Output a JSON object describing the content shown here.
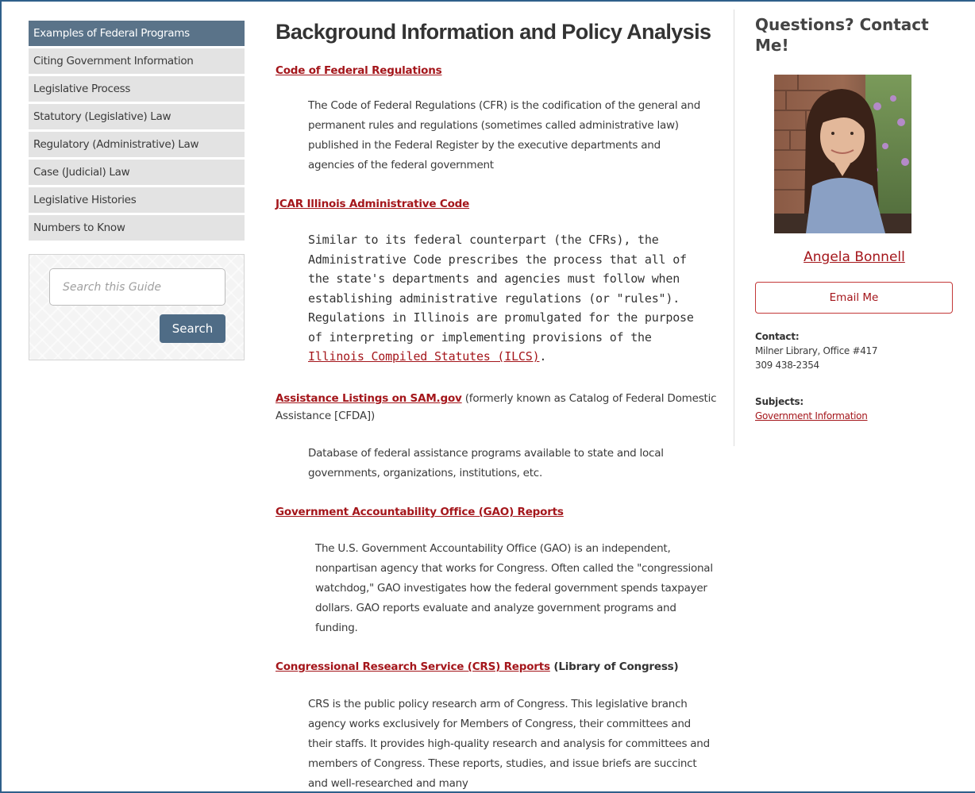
{
  "sidebar": {
    "items": [
      {
        "label": "Examples of Federal Programs",
        "active": true
      },
      {
        "label": "Citing Government Information",
        "active": false
      },
      {
        "label": "Legislative Process",
        "active": false
      },
      {
        "label": "Statutory (Legislative) Law",
        "active": false
      },
      {
        "label": "Regulatory (Administrative) Law",
        "active": false
      },
      {
        "label": "Case (Judicial) Law",
        "active": false
      },
      {
        "label": "Legislative Histories",
        "active": false
      },
      {
        "label": "Numbers to Know",
        "active": false
      }
    ]
  },
  "search": {
    "placeholder": "Search this Guide",
    "button_label": "Search"
  },
  "main": {
    "title": "Background Information and Policy Analysis",
    "resources": [
      {
        "link": "Code of Federal Regulations",
        "description": "The Code of Federal Regulations (CFR) is the codification of the general and permanent rules and regulations (sometimes called administrative law) published in the Federal Register by the executive departments and agencies of the federal government"
      },
      {
        "link": "JCAR Illinois Administrative Code",
        "description_before": "Similar to its federal counterpart (the CFRs), the Administrative Code prescribes the process that all of the state's departments and agencies must follow when establishing administrative regulations (or \"rules\"). Regulations in Illinois are promulgated for the purpose of interpreting or implementing provisions of the ",
        "description_link": "Illinois Compiled Statutes (ILCS)",
        "description_after": "."
      },
      {
        "link": "Assistance Listings on SAM.gov",
        "link_suffix": " (formerly known as Catalog of Federal Domestic Assistance [CFDA])",
        "description": "Database of federal assistance programs available to state and local governments, organizations, institutions, etc."
      },
      {
        "link": "Government Accountability Office (GAO) Reports",
        "description": "The U.S. Government Accountability Office (GAO) is an independent, nonpartisan agency that works for Congress. Often called the \"congressional watchdog,\" GAO investigates how the federal government spends taxpayer dollars. GAO reports evaluate and analyze government programs and funding."
      },
      {
        "link": "Congressional Research Service (CRS) Reports",
        "link_suffix": " (Library of Congress)",
        "description": "CRS is the public policy research arm of Congress. This legislative branch agency works exclusively for Members of Congress, their committees and their staffs. It provides high-quality research and analysis for committees and members of Congress. These reports, studies, and issue briefs are succinct and well-researched and many"
      }
    ]
  },
  "profile": {
    "heading": "Questions? Contact Me!",
    "name": "Angela Bonnell",
    "email_button": "Email Me",
    "contact_label": "Contact:",
    "contact_lines": [
      "Milner Library, Office #417",
      "309 438-2354"
    ],
    "subjects_label": "Subjects:",
    "subjects": [
      "Government Information"
    ]
  },
  "colors": {
    "accent_link": "#a4161b",
    "nav_active": "#5a7389",
    "search_button": "#4f6c86",
    "frame_border": "#2f5f8a"
  }
}
